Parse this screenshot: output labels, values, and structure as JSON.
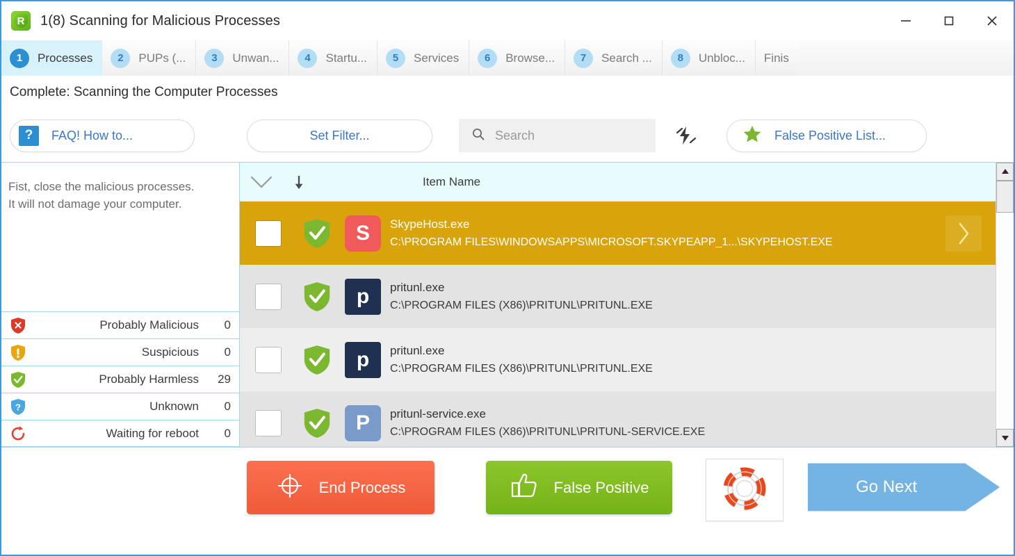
{
  "window": {
    "title": "1(8) Scanning for Malicious Processes",
    "logo_letter": "R",
    "controls": {
      "minimize": "minimize-button",
      "maximize": "maximize-button",
      "close": "close-button"
    }
  },
  "tabs": [
    {
      "num": "1",
      "label": "Processes",
      "active": true
    },
    {
      "num": "2",
      "label": "PUPs (...",
      "active": false
    },
    {
      "num": "3",
      "label": "Unwan...",
      "active": false
    },
    {
      "num": "4",
      "label": "Startu...",
      "active": false
    },
    {
      "num": "5",
      "label": "Services",
      "active": false
    },
    {
      "num": "6",
      "label": "Browse...",
      "active": false
    },
    {
      "num": "7",
      "label": "Search ...",
      "active": false
    },
    {
      "num": "8",
      "label": "Unbloc...",
      "active": false
    },
    {
      "num": "",
      "label": "Finis",
      "active": false
    }
  ],
  "status": {
    "text": "Complete: Scanning the Computer Processes"
  },
  "toolbar": {
    "faq_label": "FAQ! How to...",
    "faq_icon_glyph": "?",
    "set_filter_label": "Set Filter...",
    "search_placeholder": "Search",
    "search_value": "",
    "false_positive_list_label": "False Positive List..."
  },
  "sidebar": {
    "note_line1": "Fist, close the malicious processes.",
    "note_line2": "It will not damage your computer.",
    "stats": [
      {
        "icon": "shield-malicious-icon",
        "label": "Probably Malicious",
        "value": "0",
        "color": "#d93a2b"
      },
      {
        "icon": "shield-suspicious-icon",
        "label": "Suspicious",
        "value": "0",
        "color": "#e8a712"
      },
      {
        "icon": "shield-harmless-icon",
        "label": "Probably Harmless",
        "value": "29",
        "color": "#7cb82f"
      },
      {
        "icon": "shield-unknown-icon",
        "label": "Unknown",
        "value": "0",
        "color": "#4aa8e0"
      },
      {
        "icon": "reboot-icon",
        "label": "Waiting for reboot",
        "value": "0",
        "color": "#e8402a"
      }
    ]
  },
  "list": {
    "header": {
      "chevron_icon": "chevron-down-icon",
      "sort_icon": "sort-descending-icon",
      "item_name_column": "Item Name"
    },
    "rows": [
      {
        "name": "SkypeHost.exe",
        "path": "C:\\PROGRAM FILES\\WINDOWSAPPS\\MICROSOFT.SKYPEAPP_1...\\SKYPEHOST.EXE",
        "checked": false,
        "selected": true,
        "shield": "shield-harmless-icon",
        "app_letter": "S",
        "app_icon_color": "#f05a5a",
        "app_letter_color": "#ffffff",
        "has_go_chevron": true
      },
      {
        "name": "pritunl.exe",
        "path": "C:\\PROGRAM FILES (X86)\\PRITUNL\\PRITUNL.EXE",
        "checked": false,
        "selected": false,
        "shield": "shield-harmless-icon",
        "app_letter": "p",
        "app_icon_color": "#1f3050",
        "app_letter_color": "#ffffff",
        "has_go_chevron": false
      },
      {
        "name": "pritunl.exe",
        "path": "C:\\PROGRAM FILES (X86)\\PRITUNL\\PRITUNL.EXE",
        "checked": false,
        "selected": false,
        "shield": "shield-harmless-icon",
        "app_letter": "p",
        "app_icon_color": "#1f3050",
        "app_letter_color": "#ffffff",
        "has_go_chevron": false
      },
      {
        "name": "pritunl-service.exe",
        "path": "C:\\PROGRAM FILES (X86)\\PRITUNL\\PRITUNL-SERVICE.EXE",
        "checked": false,
        "selected": false,
        "shield": "shield-harmless-icon",
        "app_letter": "P",
        "app_icon_color": "#7a9bc9",
        "app_letter_color": "#ffffff",
        "has_go_chevron": false
      }
    ]
  },
  "footer": {
    "end_process_label": "End Process",
    "end_process_icon": "crosshair-icon",
    "false_positive_label": "False Positive",
    "false_positive_icon": "thumbs-up-icon",
    "help_icon": "lifebuoy-icon",
    "go_next_label": "Go Next"
  },
  "colors": {
    "accent_blue": "#3d9ae0",
    "selected_row": "#d9a40b",
    "danger_red": "#f05a38",
    "success_green": "#7cb82f",
    "next_blue": "#74b4e4"
  }
}
